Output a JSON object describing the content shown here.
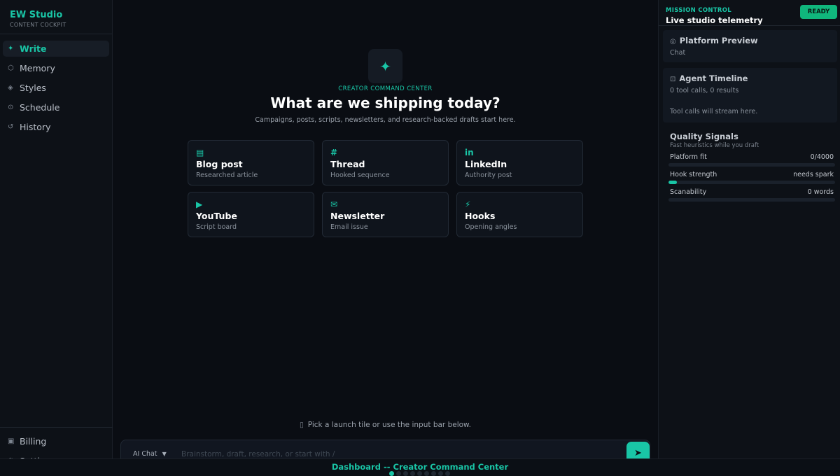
{
  "sidebar": {
    "brand_title": "EW Studio",
    "brand_sub": "CONTENT COCKPIT",
    "items": [
      {
        "label": "Write",
        "icon": "sparkle-icon",
        "glyph": "✦",
        "active": true
      },
      {
        "label": "Memory",
        "icon": "hexagon-icon",
        "glyph": "⬡"
      },
      {
        "label": "Styles",
        "icon": "diamond-icon",
        "glyph": "◈"
      },
      {
        "label": "Schedule",
        "icon": "clock-icon",
        "glyph": "⊙"
      },
      {
        "label": "History",
        "icon": "history-icon",
        "glyph": "↺"
      }
    ],
    "bottom_items": [
      {
        "label": "Billing",
        "icon": "billing-icon",
        "glyph": "▣"
      },
      {
        "label": "Settings",
        "icon": "gear-icon",
        "glyph": "⚙"
      }
    ]
  },
  "main": {
    "hero_icon": "✦",
    "eyebrow": "CREATOR COMMAND CENTER",
    "headline": "What are we shipping today?",
    "subline": "Campaigns, posts, scripts, newsletters, and research-backed drafts start here.",
    "tiles": [
      {
        "icon": "document-icon",
        "glyph": "▤",
        "title": "Blog post",
        "sub": "Researched article"
      },
      {
        "icon": "hash-icon",
        "glyph": "#",
        "title": "Thread",
        "sub": "Hooked sequence"
      },
      {
        "icon": "linkedin-icon",
        "glyph": "in",
        "title": "LinkedIn",
        "sub": "Authority post"
      },
      {
        "icon": "play-icon",
        "glyph": "▶",
        "title": "YouTube",
        "sub": "Script board"
      },
      {
        "icon": "mail-icon",
        "glyph": "✉",
        "title": "Newsletter",
        "sub": "Email issue"
      },
      {
        "icon": "bolt-icon",
        "glyph": "⚡",
        "title": "Hooks",
        "sub": "Opening angles"
      }
    ],
    "hint": "Pick a launch tile or use the input bar below.",
    "input": {
      "mode": "AI  Chat",
      "placeholder": "Brainstorm, draft, research, or start with /",
      "value": ""
    }
  },
  "right": {
    "eyebrow": "MISSION CONTROL",
    "title": "Live studio telemetry",
    "status": "READY",
    "preview": {
      "title": "Platform Preview",
      "sub": "Chat"
    },
    "timeline": {
      "title": "Agent Timeline",
      "sub": "0 tool calls, 0 results",
      "note": "Tool calls will stream here."
    },
    "quality": {
      "title": "Quality Signals",
      "sub": "Fast heuristics while you draft",
      "metrics": [
        {
          "label": "Platform fit",
          "value": "0/4000",
          "level": 0
        },
        {
          "label": "Hook strength",
          "value": "needs spark",
          "level": 0.05
        },
        {
          "label": "Scanability",
          "value": "0 words",
          "level": 0
        }
      ]
    }
  },
  "footer": {
    "title": "Dashboard -- Creator Command Center",
    "page_count": 9,
    "active_page": 1
  },
  "colors": {
    "accent": "#19c5a6",
    "ready": "#10b67c",
    "background": "#0a0d13"
  }
}
